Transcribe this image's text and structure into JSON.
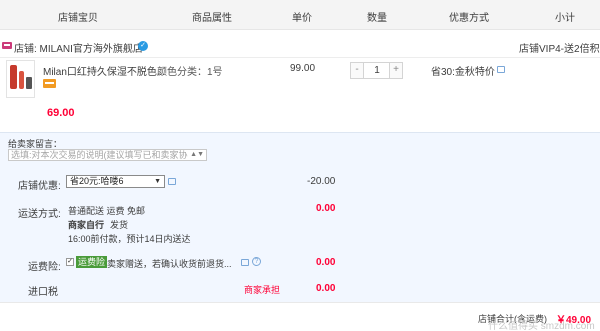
{
  "header": {
    "shop_item": "店铺宝贝",
    "attributes": "商品属性",
    "unit_price": "单价",
    "quantity": "数量",
    "promo": "优惠方式",
    "subtotal": "小计"
  },
  "shop": {
    "label": "店铺: MILANI官方海外旗舰店",
    "vip_text": "店铺VIP4-送2倍积分"
  },
  "item": {
    "title": "Milan口红持久保湿不脱色...",
    "attr": "颜色分类：1号",
    "price": "99.00",
    "qty": "1",
    "minus": "-",
    "plus": "+",
    "promo": "省30:金秋特价",
    "final_price": "69.00"
  },
  "message": {
    "label": "给卖家留言：",
    "placeholder": "选填:对本次交易的说明(建议填写已和卖家协"
  },
  "shop_discount": {
    "label": "店铺优惠:",
    "selected": "省20元:哈喽6",
    "amount": "-20.00"
  },
  "shipping": {
    "label": "运送方式:",
    "line1": "普通配送 运费 免邮",
    "line2_bold": "商家自行",
    "line2_rest": "发货",
    "line3": "16:00前付款，预计14日内送达",
    "amount": "0.00"
  },
  "insurance": {
    "label": "运费险:",
    "tag": "运费险",
    "text": "卖家赠送，若确认收货前退货...",
    "amount": "0.00"
  },
  "import_tax": {
    "label": "进口税",
    "note": "商家承担",
    "amount": "0.00"
  },
  "total": {
    "label": "店铺合计(含运费)",
    "amount": "￥49.00"
  },
  "watermark": "什么值得买 smzdm.com",
  "colors": {
    "accent_red": "#ff0036",
    "panel_blue": "#f2f7ff",
    "insurance_green": "#4a9b3a"
  }
}
